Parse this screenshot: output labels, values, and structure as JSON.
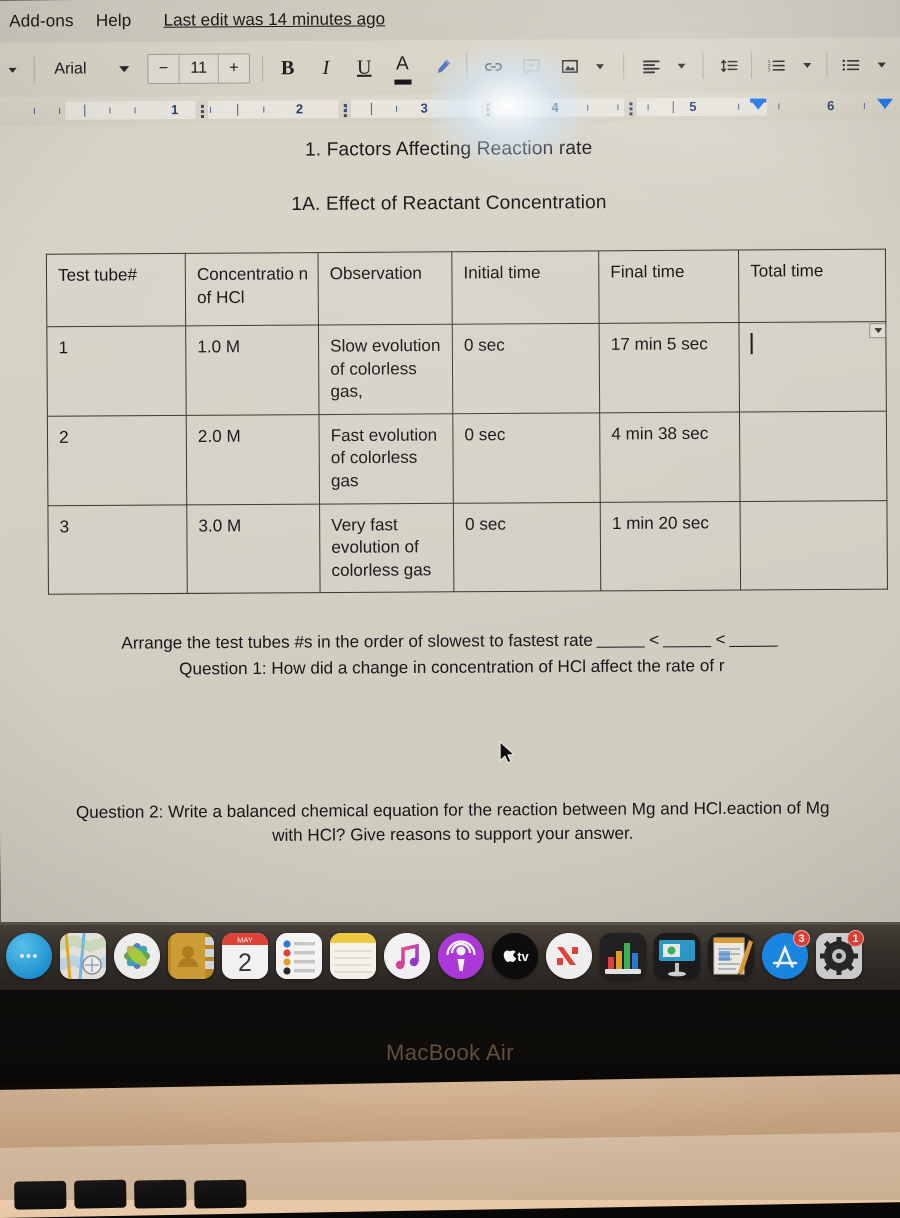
{
  "app": {
    "menu_items": [
      "Add-ons",
      "Help"
    ],
    "last_edit": "Last edit was 14 minutes ago"
  },
  "toolbar": {
    "font_name": "Arial",
    "font_size": "11",
    "decrease_label": "−",
    "increase_label": "+",
    "bold_label": "B",
    "italic_label": "I",
    "underline_label": "U",
    "text_color_label": "A",
    "text_color_swatch": "#16161a",
    "highlight_color": "#4b6cc4",
    "icons": [
      "undo-icon",
      "bold-icon",
      "italic-icon",
      "underline-icon",
      "text-color-icon",
      "highlight-icon",
      "insert-link-icon",
      "add-comment-icon",
      "insert-image-icon",
      "align-icon",
      "line-spacing-icon",
      "numbered-list-icon",
      "bulleted-list-icon"
    ]
  },
  "ruler": {
    "numbers": [
      "1",
      "2",
      "3",
      "4",
      "5",
      "6"
    ]
  },
  "document": {
    "heading1": "1. Factors Affecting Reaction rate",
    "heading2": "1A. Effect of Reactant Concentration",
    "table": {
      "headers": [
        "Test tube#",
        "Concentratio n of HCl",
        "Observation",
        "Initial time",
        "Final time",
        "Total time"
      ],
      "rows": [
        {
          "test_tube": "1",
          "concentration": "1.0 M",
          "observation": "Slow evolution of colorless gas,",
          "initial_time": "0 sec",
          "final_time": "17 min 5 sec",
          "total_time": ""
        },
        {
          "test_tube": "2",
          "concentration": "2.0 M",
          "observation": "Fast evolution of colorless gas",
          "initial_time": "0 sec",
          "final_time": "4 min 38 sec",
          "total_time": ""
        },
        {
          "test_tube": "3",
          "concentration": "3.0 M",
          "observation": "Very fast evolution of colorless gas",
          "initial_time": "0 sec",
          "final_time": "1 min 20 sec",
          "total_time": ""
        }
      ]
    },
    "arrange_line": "Arrange the test tubes #s in the order of slowest to fastest rate",
    "arrange_op1": "<",
    "arrange_op2": "<",
    "question1": "Question 1: How did a change in concentration of HCl affect the rate of r",
    "question2": "Question 2: Write a balanced chemical equation for the reaction between Mg and HCl.eaction of Mg with HCl? Give reasons to support your answer."
  },
  "dock": {
    "items": [
      {
        "name": "messages",
        "label": "Messages",
        "badge": ""
      },
      {
        "name": "maps",
        "label": "Maps",
        "badge": ""
      },
      {
        "name": "photos",
        "label": "Photos",
        "badge": ""
      },
      {
        "name": "contacts",
        "label": "Contacts",
        "badge": ""
      },
      {
        "name": "calendar",
        "label": "Calendar",
        "badge": "",
        "month": "MAY",
        "day": "2"
      },
      {
        "name": "reminders",
        "label": "Reminders",
        "badge": ""
      },
      {
        "name": "notes",
        "label": "Notes",
        "badge": ""
      },
      {
        "name": "music",
        "label": "Music",
        "badge": ""
      },
      {
        "name": "podcasts",
        "label": "Podcasts",
        "badge": ""
      },
      {
        "name": "tv",
        "label": "TV",
        "badge": ""
      },
      {
        "name": "news",
        "label": "News",
        "badge": ""
      },
      {
        "name": "numbers",
        "label": "Numbers",
        "badge": ""
      },
      {
        "name": "keynote",
        "label": "Keynote",
        "badge": ""
      },
      {
        "name": "pages",
        "label": "Pages",
        "badge": ""
      },
      {
        "name": "appstore",
        "label": "App Store",
        "badge": "3"
      },
      {
        "name": "prefs",
        "label": "System Preferences",
        "badge": "1"
      }
    ]
  },
  "hardware": {
    "model_label": "MacBook Air"
  }
}
